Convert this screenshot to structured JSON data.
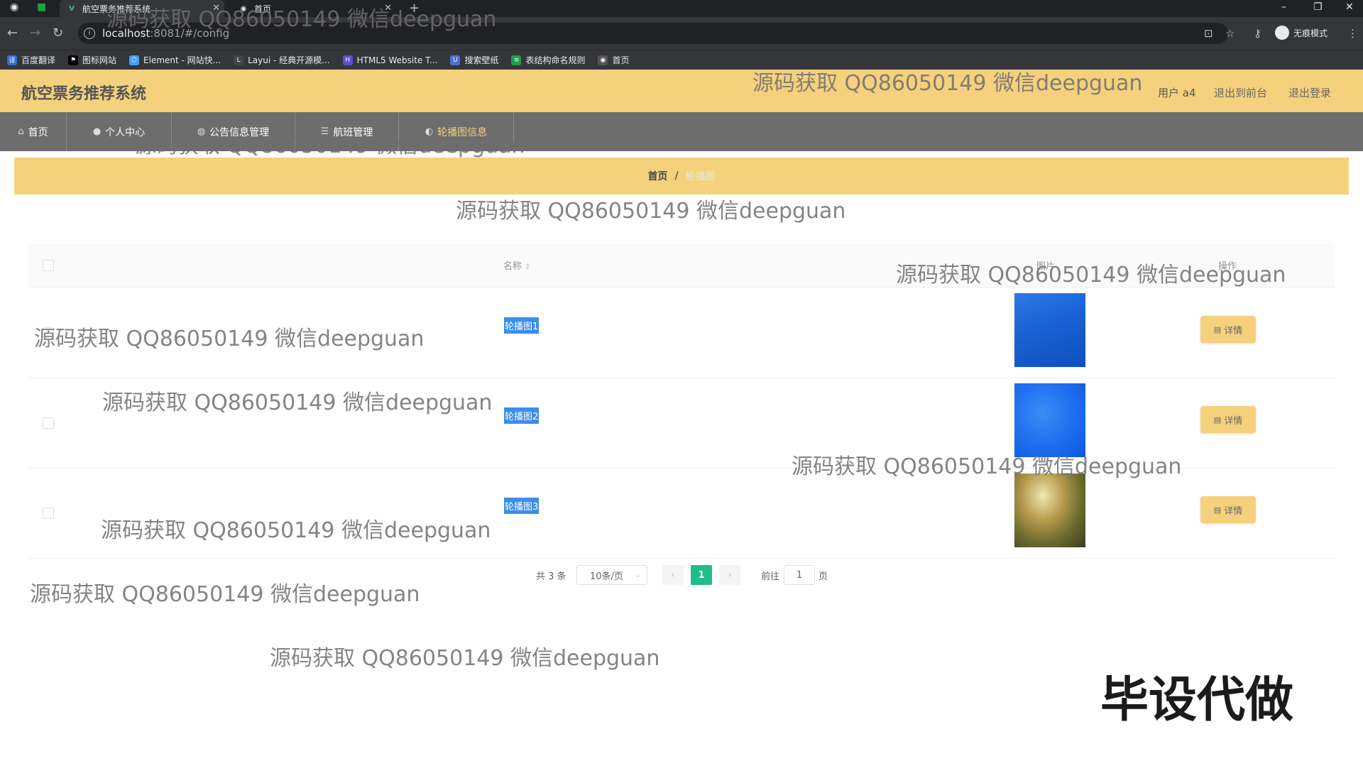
{
  "browser": {
    "tabs": [
      {
        "title": "航空票务推荐系统",
        "active": true
      },
      {
        "title": "首页",
        "active": false
      }
    ],
    "url_host": "localhost",
    "url_path": ":8081/#/config",
    "incognito_label": "无痕模式",
    "bookmarks": [
      {
        "label": "百度翻译",
        "color": "#2f6bd8"
      },
      {
        "label": "图标网站",
        "color": "#000000"
      },
      {
        "label": "Element - 网站快...",
        "color": "#409eff"
      },
      {
        "label": "Layui - 经典开源模...",
        "color": "#444444"
      },
      {
        "label": "HTML5 Website T...",
        "color": "#5b4bd6"
      },
      {
        "label": "搜索壁纸",
        "color": "#4a6fd8"
      },
      {
        "label": "表结构命名规则",
        "color": "#1e9e4a"
      },
      {
        "label": "首页",
        "color": "#555555"
      }
    ]
  },
  "header": {
    "title": "航空票务推荐系统",
    "user_label": "用户 a4",
    "back_label": "退出到前台",
    "logout_label": "退出登录"
  },
  "nav": {
    "items": [
      {
        "label": "首页",
        "icon": "home-icon"
      },
      {
        "label": "个人中心",
        "icon": "user-icon"
      },
      {
        "label": "公告信息管理",
        "icon": "notice-icon"
      },
      {
        "label": "航班管理",
        "icon": "menu-icon"
      },
      {
        "label": "轮播图信息",
        "icon": "image-icon",
        "active": true
      }
    ]
  },
  "breadcrumb": {
    "home": "首页",
    "separator": "/",
    "current": "轮播图"
  },
  "table": {
    "headers": {
      "name": "名称",
      "image": "图片",
      "action": "操作"
    },
    "rows": [
      {
        "name": "轮播图1",
        "detail_label": "详情"
      },
      {
        "name": "轮播图2",
        "detail_label": "详情"
      },
      {
        "name": "轮播图3",
        "detail_label": "详情"
      }
    ]
  },
  "pagination": {
    "total_label": "共 3 条",
    "page_size": "10条/页",
    "current_page": "1",
    "goto_label": "前往",
    "goto_value": "1",
    "page_suffix": "页"
  },
  "watermarks": [
    "源码获取 QQ86050149 微信deepguan",
    "源码获取 QQ86050149 微信deepguan",
    "源码获取 QQ86050149 微信deepguan",
    "源码获取 QQ86050149 微信deepguan",
    "源码获取 QQ86050149 微信deepguan",
    "源码获取 QQ86050149 微信deepguan",
    "源码获取 QQ86050149 微信deepguan",
    "源码获取 QQ86050149 微信deepguan",
    "源码获取 QQ86050149 微信deepguan",
    "源码获取 QQ86050149 微信deepguan",
    "源码获取 QQ86050149 微信deepguan"
  ],
  "stamp": "毕设代做",
  "colors": {
    "accent": "#f5d17d",
    "nav_bg": "#6d6d6d",
    "active_page": "#1fbd8a"
  }
}
